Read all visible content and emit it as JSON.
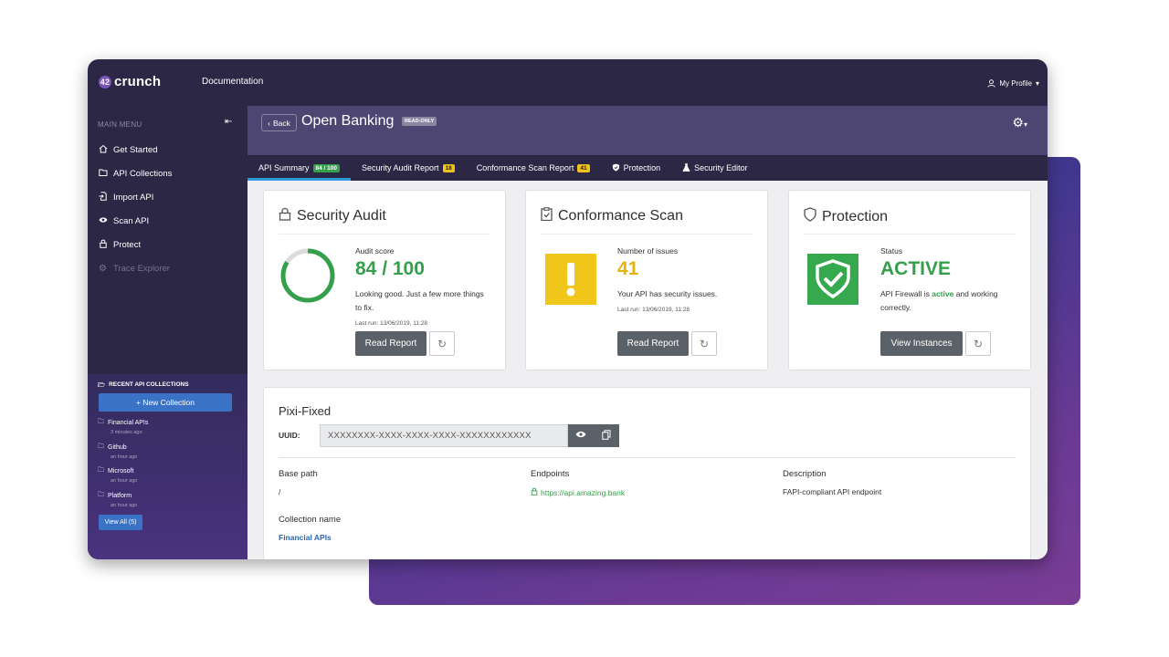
{
  "app": {
    "logo": "crunch",
    "nav_documentation": "Documentation",
    "profile": "My Profile"
  },
  "sidebar": {
    "menu_title": "MAIN MENU",
    "items": [
      {
        "label": "Get Started",
        "icon": "home-icon",
        "enabled": true
      },
      {
        "label": "API Collections",
        "icon": "folder-open-icon",
        "enabled": true
      },
      {
        "label": "Import API",
        "icon": "import-file-icon",
        "enabled": true
      },
      {
        "label": "Scan API",
        "icon": "eye-icon",
        "enabled": true
      },
      {
        "label": "Protect",
        "icon": "lock-icon",
        "enabled": true
      },
      {
        "label": "Trace Explorer",
        "icon": "gear-icon",
        "enabled": false
      }
    ],
    "recent": {
      "title": "RECENT API COLLECTIONS",
      "new_collection": "+ New Collection",
      "collections": [
        {
          "name": "Financial APIs",
          "time": "3 minutes ago"
        },
        {
          "name": "Github",
          "time": "an hour ago"
        },
        {
          "name": "Microsoft",
          "time": "an hour ago"
        },
        {
          "name": "Platform",
          "time": "an hour ago"
        }
      ],
      "view_all": "View All (5)"
    }
  },
  "header": {
    "back": "Back",
    "title": "Open Banking",
    "read_only": "READ-ONLY",
    "tabs": [
      {
        "label": "API Summary",
        "badge": "84 / 100",
        "badge_color": "green",
        "active": true
      },
      {
        "label": "Security Audit Report",
        "badge": "18",
        "badge_color": "yellow"
      },
      {
        "label": "Conformance Scan Report",
        "badge": "41",
        "badge_color": "yellow"
      },
      {
        "label": "Protection",
        "icon": "shield-icon"
      },
      {
        "label": "Security Editor",
        "icon": "flask-icon"
      }
    ]
  },
  "cards": {
    "audit": {
      "title": "Security Audit",
      "label": "Audit score",
      "value": "84 / 100",
      "score_fraction": 0.84,
      "desc": "Looking good. Just a few more things to fix.",
      "last_run": "Last run: 13/06/2019, 11:28",
      "button": "Read Report",
      "color": "#35a04b"
    },
    "scan": {
      "title": "Conformance Scan",
      "label": "Number of issues",
      "value": "41",
      "desc": "Your API has security issues.",
      "last_run": "Last run: 13/06/2019, 11:28",
      "button": "Read Report",
      "color": "#f1c61b"
    },
    "protection": {
      "title": "Protection",
      "label": "Status",
      "value": "ACTIVE",
      "desc_pre": "API Firewall is ",
      "desc_active": "active",
      "desc_post": " and working correctly.",
      "button": "View Instances",
      "color": "#35a04b"
    }
  },
  "api": {
    "name": "Pixi-Fixed",
    "uuid_label": "UUID:",
    "uuid_value": "XXXXXXXX-XXXX-XXXX-XXXX-XXXXXXXXXXXX",
    "base_path_label": "Base path",
    "base_path": "/",
    "endpoints_label": "Endpoints",
    "endpoint": "https://api.amazing.bank",
    "description_label": "Description",
    "description": "FAPI-compliant API endpoint",
    "collection_label": "Collection name",
    "collection": "Financial APIs"
  }
}
